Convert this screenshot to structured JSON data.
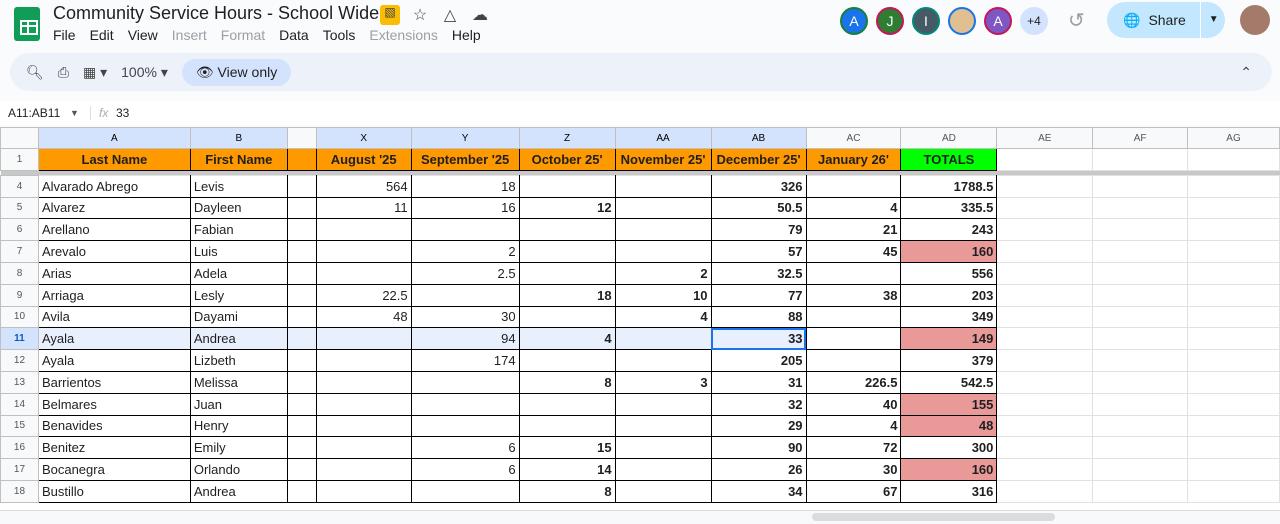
{
  "app": {
    "title": "Community Service Hours - School Wide",
    "menu": [
      "File",
      "Edit",
      "View",
      "Insert",
      "Format",
      "Data",
      "Tools",
      "Extensions",
      "Help"
    ],
    "menu_disabled": [
      "Insert",
      "Format",
      "Extensions"
    ]
  },
  "toolbar": {
    "zoom": "100%",
    "view_only": "View only"
  },
  "formula_bar": {
    "name_box": "A11:AB11",
    "fx": "fx",
    "value": "33"
  },
  "collaborators": [
    {
      "initial": "A",
      "bg": "#1a73e8",
      "ring": "#188038"
    },
    {
      "initial": "J",
      "bg": "#2e7d32",
      "ring": "#c2185b"
    },
    {
      "initial": "I",
      "bg": "#455a64",
      "ring": "#00897b"
    },
    {
      "initial": "",
      "bg": "#e0c090",
      "ring": "#1a73e8"
    },
    {
      "initial": "A",
      "bg": "#7e57c2",
      "ring": "#c2185b"
    }
  ],
  "more_collaborators": "+4",
  "share": {
    "label": "Share"
  },
  "columns": [
    "A",
    "B",
    "",
    "X",
    "Y",
    "Z",
    "AA",
    "AB",
    "AC",
    "AD",
    "AE",
    "AF",
    "AG"
  ],
  "header_row": {
    "row": "1",
    "cells": [
      "Last Name",
      "First Name",
      "",
      "August '25",
      "September '25",
      "October 25'",
      "November 25'",
      "December 25'",
      "January 26'",
      "TOTALS"
    ]
  },
  "rows": [
    {
      "n": "4",
      "last": "Alvarado Abrego",
      "first": "Levis",
      "v": [
        "564",
        "18",
        "",
        "",
        "326",
        "",
        "1788.5"
      ],
      "red": false
    },
    {
      "n": "5",
      "last": "Alvarez",
      "first": "Dayleen",
      "v": [
        "11",
        "16",
        "12",
        "",
        "50.5",
        "4",
        "335.5"
      ],
      "red": false
    },
    {
      "n": "6",
      "last": "Arellano",
      "first": "Fabian",
      "v": [
        "",
        "",
        "",
        "",
        "79",
        "21",
        "243"
      ],
      "red": false
    },
    {
      "n": "7",
      "last": "Arevalo",
      "first": "Luis",
      "v": [
        "",
        "2",
        "",
        "",
        "57",
        "45",
        "160"
      ],
      "red": true
    },
    {
      "n": "8",
      "last": "Arias",
      "first": "Adela",
      "v": [
        "",
        "2.5",
        "",
        "2",
        "32.5",
        "",
        "556"
      ],
      "red": false
    },
    {
      "n": "9",
      "last": "Arriaga",
      "first": "Lesly",
      "v": [
        "22.5",
        "",
        "18",
        "10",
        "77",
        "38",
        "203"
      ],
      "red": false
    },
    {
      "n": "10",
      "last": "Avila",
      "first": "Dayami",
      "v": [
        "48",
        "30",
        "",
        "4",
        "88",
        "",
        "349"
      ],
      "red": false
    },
    {
      "n": "11",
      "last": "Ayala",
      "first": "Andrea",
      "v": [
        "",
        "94",
        "4",
        "",
        "33",
        "",
        "149"
      ],
      "red": true
    },
    {
      "n": "12",
      "last": "Ayala",
      "first": "Lizbeth",
      "v": [
        "",
        "174",
        "",
        "",
        "205",
        "",
        "379"
      ],
      "red": false
    },
    {
      "n": "13",
      "last": "Barrientos",
      "first": "Melissa",
      "v": [
        "",
        "",
        "8",
        "3",
        "31",
        "226.5",
        "542.5"
      ],
      "red": false
    },
    {
      "n": "14",
      "last": "Belmares",
      "first": "Juan",
      "v": [
        "",
        "",
        "",
        "",
        "32",
        "40",
        "155"
      ],
      "red": true
    },
    {
      "n": "15",
      "last": "Benavides",
      "first": "Henry",
      "v": [
        "",
        "",
        "",
        "",
        "29",
        "4",
        "48"
      ],
      "red": true
    },
    {
      "n": "16",
      "last": "Benitez",
      "first": "Emily",
      "v": [
        "",
        "6",
        "15",
        "",
        "90",
        "72",
        "300"
      ],
      "red": false
    },
    {
      "n": "17",
      "last": "Bocanegra",
      "first": "Orlando",
      "v": [
        "",
        "6",
        "14",
        "",
        "26",
        "30",
        "160"
      ],
      "red": true
    },
    {
      "n": "18",
      "last": "Bustillo",
      "first": "Andrea",
      "v": [
        "",
        "",
        "8",
        "",
        "34",
        "67",
        "316"
      ],
      "red": false
    }
  ]
}
